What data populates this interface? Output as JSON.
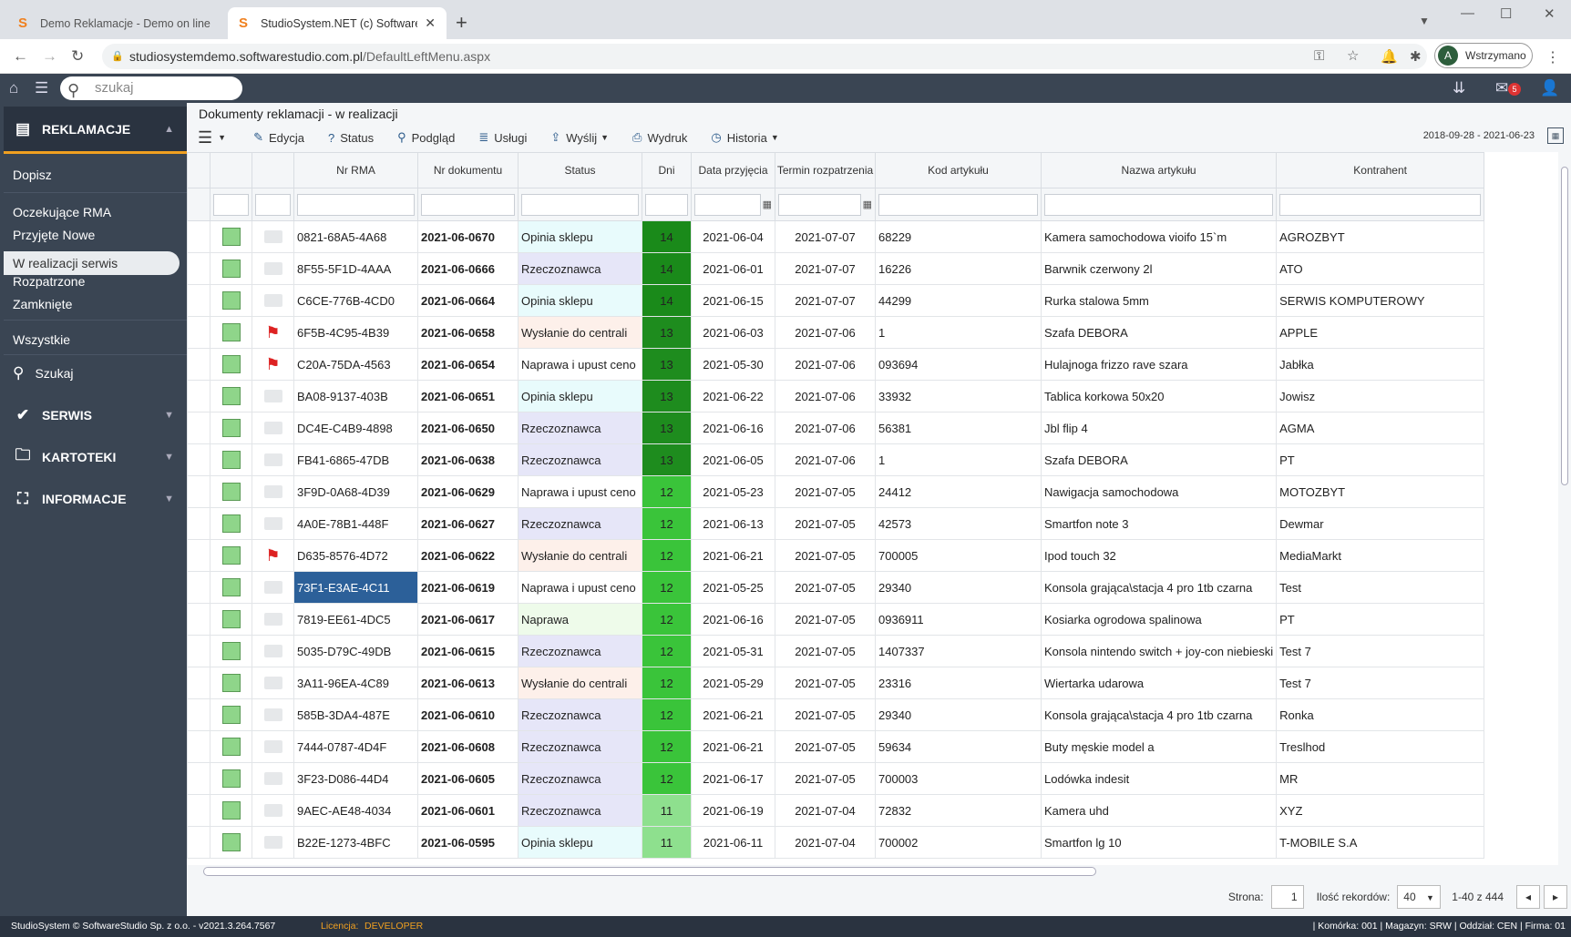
{
  "browser": {
    "tabs": [
      {
        "title": "Demo Reklamacje - Demo on line"
      },
      {
        "title": "StudioSystem.NET (c) SoftwareStudio"
      }
    ],
    "url_host": "studiosystemdemo.softwarestudio.com.pl",
    "url_path": "/DefaultLeftMenu.aspx",
    "profile_initial": "A",
    "profile_status": "Wstrzymano"
  },
  "app": {
    "search_placeholder": "szukaj",
    "mail_badge": "5"
  },
  "sidebar": {
    "section1": "REKLAMACJE",
    "items1": [
      "Dopisz",
      "Oczekujące RMA",
      "Przyjęte Nowe",
      "W realizacji serwis",
      "Rozpatrzone",
      "Zamknięte",
      "Wszystkie"
    ],
    "search": "Szukaj",
    "section2": "SERWIS",
    "section3": "KARTOTEKI",
    "section4": "INFORMACJE"
  },
  "page": {
    "breadcrumb": "Dokumenty reklamacji - w realizacji",
    "date_range": "2018-09-28 - 2021-06-23"
  },
  "toolbar": {
    "edit": "Edycja",
    "status": "Status",
    "preview": "Podgląd",
    "services": "Usługi",
    "send": "Wyślij",
    "print": "Wydruk",
    "history": "Historia"
  },
  "columns": [
    "Nr RMA",
    "Nr dokumentu",
    "Status",
    "Dni",
    "Data przyjęcia",
    "Termin rozpatrzenia",
    "Kod artykułu",
    "Nazwa artykułu",
    "Kontrahent"
  ],
  "status_colors": {
    "Opinia sklepu": "#e8fbfc",
    "Rzeczoznawca": "#e6e6f8",
    "Wysłanie do centrali": "#fdf0ea",
    "Naprawa i upust ceno": "#ffffff",
    "Naprawa": "#eefbea"
  },
  "dni_colors": {
    "14": "#1a8a1a",
    "13": "#1e8c1e",
    "12": "#3ac43a",
    "11": "#8ee08e"
  },
  "rows": [
    {
      "flag": false,
      "rma": "0821-68A5-4A68",
      "doc": "2021-06-0670",
      "status": "Opinia sklepu",
      "dni": "14",
      "data": "2021-06-04",
      "termin": "2021-07-07",
      "kod": "68229",
      "nazwa": "Kamera samochodowa vioifo 15`m",
      "kontrahent": "AGROZBYT"
    },
    {
      "flag": false,
      "rma": "8F55-5F1D-4AAA",
      "doc": "2021-06-0666",
      "status": "Rzeczoznawca",
      "dni": "14",
      "data": "2021-06-01",
      "termin": "2021-07-07",
      "kod": "16226",
      "nazwa": "Barwnik czerwony 2l",
      "kontrahent": "ATO"
    },
    {
      "flag": false,
      "rma": "C6CE-776B-4CD0",
      "doc": "2021-06-0664",
      "status": "Opinia sklepu",
      "dni": "14",
      "data": "2021-06-15",
      "termin": "2021-07-07",
      "kod": "44299",
      "nazwa": "Rurka stalowa 5mm",
      "kontrahent": "SERWIS KOMPUTEROWY"
    },
    {
      "flag": true,
      "rma": "6F5B-4C95-4B39",
      "doc": "2021-06-0658",
      "status": "Wysłanie do centrali",
      "dni": "13",
      "data": "2021-06-03",
      "termin": "2021-07-06",
      "kod": "1",
      "nazwa": "Szafa DEBORA",
      "kontrahent": "APPLE"
    },
    {
      "flag": true,
      "rma": "C20A-75DA-4563",
      "doc": "2021-06-0654",
      "status": "Naprawa i upust ceno",
      "dni": "13",
      "data": "2021-05-30",
      "termin": "2021-07-06",
      "kod": "093694",
      "nazwa": "Hulajnoga frizzo rave szara",
      "kontrahent": "Jabłka"
    },
    {
      "flag": false,
      "rma": "BA08-9137-403B",
      "doc": "2021-06-0651",
      "status": "Opinia sklepu",
      "dni": "13",
      "data": "2021-06-22",
      "termin": "2021-07-06",
      "kod": "33932",
      "nazwa": "Tablica korkowa 50x20",
      "kontrahent": "Jowisz"
    },
    {
      "flag": false,
      "rma": "DC4E-C4B9-4898",
      "doc": "2021-06-0650",
      "status": "Rzeczoznawca",
      "dni": "13",
      "data": "2021-06-16",
      "termin": "2021-07-06",
      "kod": "56381",
      "nazwa": "Jbl flip 4",
      "kontrahent": "AGMA"
    },
    {
      "flag": false,
      "rma": "FB41-6865-47DB",
      "doc": "2021-06-0638",
      "status": "Rzeczoznawca",
      "dni": "13",
      "data": "2021-06-05",
      "termin": "2021-07-06",
      "kod": "1",
      "nazwa": "Szafa DEBORA",
      "kontrahent": "PT"
    },
    {
      "flag": false,
      "rma": "3F9D-0A68-4D39",
      "doc": "2021-06-0629",
      "status": "Naprawa i upust ceno",
      "dni": "12",
      "data": "2021-05-23",
      "termin": "2021-07-05",
      "kod": "24412",
      "nazwa": "Nawigacja samochodowa",
      "kontrahent": "MOTOZBYT"
    },
    {
      "flag": false,
      "rma": "4A0E-78B1-448F",
      "doc": "2021-06-0627",
      "status": "Rzeczoznawca",
      "dni": "12",
      "data": "2021-06-13",
      "termin": "2021-07-05",
      "kod": "42573",
      "nazwa": "Smartfon note 3",
      "kontrahent": "Dewmar"
    },
    {
      "flag": true,
      "rma": "D635-8576-4D72",
      "doc": "2021-06-0622",
      "status": "Wysłanie do centrali",
      "dni": "12",
      "data": "2021-06-21",
      "termin": "2021-07-05",
      "kod": "700005",
      "nazwa": "Ipod touch 32",
      "kontrahent": "MediaMarkt"
    },
    {
      "flag": false,
      "rma": "73F1-E3AE-4C11",
      "doc": "2021-06-0619",
      "status": "Naprawa i upust ceno",
      "dni": "12",
      "data": "2021-05-25",
      "termin": "2021-07-05",
      "kod": "29340",
      "nazwa": "Konsola grająca\\stacja 4 pro 1tb czarna",
      "kontrahent": "Test",
      "selected": true
    },
    {
      "flag": false,
      "rma": "7819-EE61-4DC5",
      "doc": "2021-06-0617",
      "status": "Naprawa",
      "dni": "12",
      "data": "2021-06-16",
      "termin": "2021-07-05",
      "kod": "0936911",
      "nazwa": "Kosiarka ogrodowa spalinowa",
      "kontrahent": "PT"
    },
    {
      "flag": false,
      "rma": "5035-D79C-49DB",
      "doc": "2021-06-0615",
      "status": "Rzeczoznawca",
      "dni": "12",
      "data": "2021-05-31",
      "termin": "2021-07-05",
      "kod": "1407337",
      "nazwa": "Konsola nintendo switch + joy-con niebieski",
      "kontrahent": "Test 7"
    },
    {
      "flag": false,
      "rma": "3A11-96EA-4C89",
      "doc": "2021-06-0613",
      "status": "Wysłanie do centrali",
      "dni": "12",
      "data": "2021-05-29",
      "termin": "2021-07-05",
      "kod": "23316",
      "nazwa": "Wiertarka udarowa",
      "kontrahent": "Test 7"
    },
    {
      "flag": false,
      "rma": "585B-3DA4-487E",
      "doc": "2021-06-0610",
      "status": "Rzeczoznawca",
      "dni": "12",
      "data": "2021-06-21",
      "termin": "2021-07-05",
      "kod": "29340",
      "nazwa": "Konsola grająca\\stacja 4 pro 1tb czarna",
      "kontrahent": "Ronka"
    },
    {
      "flag": false,
      "rma": "7444-0787-4D4F",
      "doc": "2021-06-0608",
      "status": "Rzeczoznawca",
      "dni": "12",
      "data": "2021-06-21",
      "termin": "2021-07-05",
      "kod": "59634",
      "nazwa": "Buty męskie model a",
      "kontrahent": "Treslhod"
    },
    {
      "flag": false,
      "rma": "3F23-D086-44D4",
      "doc": "2021-06-0605",
      "status": "Rzeczoznawca",
      "dni": "12",
      "data": "2021-06-17",
      "termin": "2021-07-05",
      "kod": "700003",
      "nazwa": "Lodówka indesit",
      "kontrahent": "MR"
    },
    {
      "flag": false,
      "rma": "9AEC-AE48-4034",
      "doc": "2021-06-0601",
      "status": "Rzeczoznawca",
      "dni": "11",
      "data": "2021-06-19",
      "termin": "2021-07-04",
      "kod": "72832",
      "nazwa": "Kamera uhd",
      "kontrahent": "XYZ"
    },
    {
      "flag": false,
      "rma": "B22E-1273-4BFC",
      "doc": "2021-06-0595",
      "status": "Opinia sklepu",
      "dni": "11",
      "data": "2021-06-11",
      "termin": "2021-07-04",
      "kod": "700002",
      "nazwa": "Smartfon lg 10",
      "kontrahent": "T-MOBILE S.A"
    }
  ],
  "pager": {
    "page_label": "Strona:",
    "page": "1",
    "count_label": "Ilość rekordów:",
    "count": "40",
    "range": "1-40 z 444"
  },
  "footer": {
    "left": "StudioSystem © SoftwareStudio Sp. z o.o. - v2021.3.264.7567",
    "lic_label": "Licencja:",
    "lic_value": "DEVELOPER",
    "right": "| Komórka: 001 | Magazyn: SRW | Oddział: CEN | Firma: 01"
  }
}
